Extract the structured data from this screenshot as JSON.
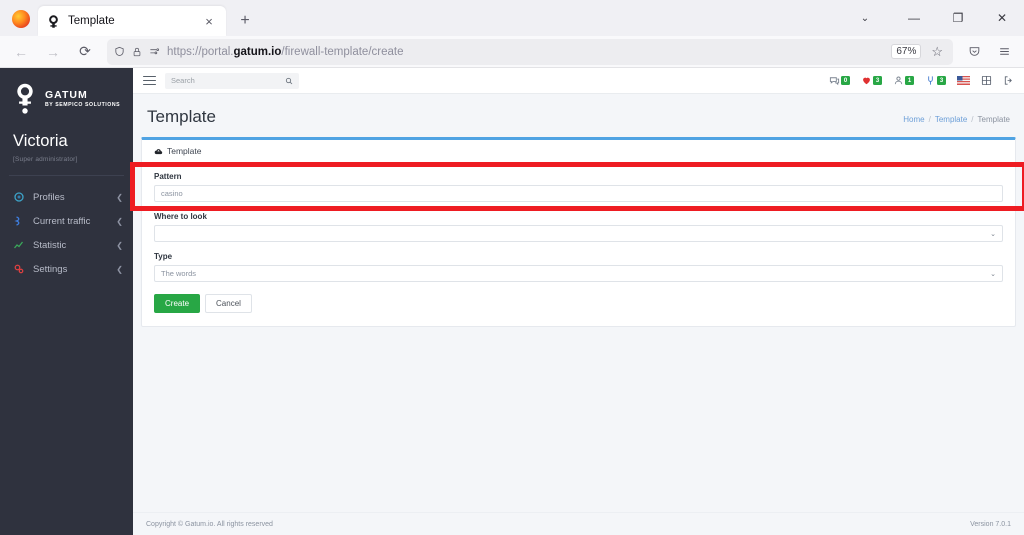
{
  "browser": {
    "tab": {
      "title": "Template",
      "favicon": "gatum-favicon-icon",
      "close": "×"
    },
    "new_tab": "+",
    "window": {
      "tab_list": "⌄",
      "minimize": "—",
      "maximize": "❐",
      "close": "✕"
    },
    "nav": {
      "back": "←",
      "forward": "→",
      "reload": "⟳"
    },
    "url": {
      "scheme": "https://portal.",
      "domain": "gatum.io",
      "path": "/firewall-template/create"
    },
    "zoom_level": "67%",
    "icons": {
      "shield": "shield-icon",
      "lock": "lock-icon",
      "permissions": "permissions-icon",
      "bookmark": "star-icon",
      "pocket": "pocket-icon",
      "app_menu": "hamburger-menu-icon"
    }
  },
  "sidebar": {
    "brand": {
      "name": "GATUM",
      "subtitle": "BY SEMPICO SOLUTIONS"
    },
    "user": {
      "name": "Victoria",
      "role": "[Super administrator]"
    },
    "items": [
      {
        "label": "Profiles",
        "icon": "profiles-icon",
        "chevron": "❮"
      },
      {
        "label": "Current traffic",
        "icon": "traffic-icon",
        "chevron": "❮"
      },
      {
        "label": "Statistic",
        "icon": "statistic-icon",
        "chevron": "❮"
      },
      {
        "label": "Settings",
        "icon": "settings-icon",
        "chevron": "❮"
      }
    ]
  },
  "topbar": {
    "menu_toggle": "hamburger-icon",
    "search": {
      "placeholder": "Search",
      "icon": "search-icon"
    },
    "indicators": [
      {
        "icon": "comments-icon",
        "count": "0"
      },
      {
        "icon": "alerts-icon",
        "count": "3"
      },
      {
        "icon": "users-icon",
        "count": "1"
      },
      {
        "icon": "connections-icon",
        "count": "3"
      }
    ],
    "language": "us-flag-icon",
    "apps": "grid-icon",
    "logout": "logout-icon"
  },
  "page": {
    "title": "Template",
    "breadcrumb": [
      {
        "label": "Home",
        "link": true
      },
      {
        "label": "Template",
        "link": true
      },
      {
        "label": "Template",
        "link": false
      }
    ],
    "breadcrumb_separator": "/"
  },
  "card": {
    "tab": {
      "label": "Template",
      "icon": "cloud-upload-icon"
    },
    "fields": [
      {
        "label": "Pattern",
        "value": "casino",
        "type": "text"
      },
      {
        "label": "Where to look",
        "value": "",
        "type": "select"
      },
      {
        "label": "Type",
        "value": "The words",
        "type": "select"
      }
    ],
    "select_chevron": "⌄",
    "buttons": {
      "create": "Create",
      "cancel": "Cancel"
    },
    "highlight_color": "#ee1c22"
  },
  "footer": {
    "copyright": "Copyright © Gatum.io. All rights reserved",
    "version": "Version 7.0.1"
  }
}
